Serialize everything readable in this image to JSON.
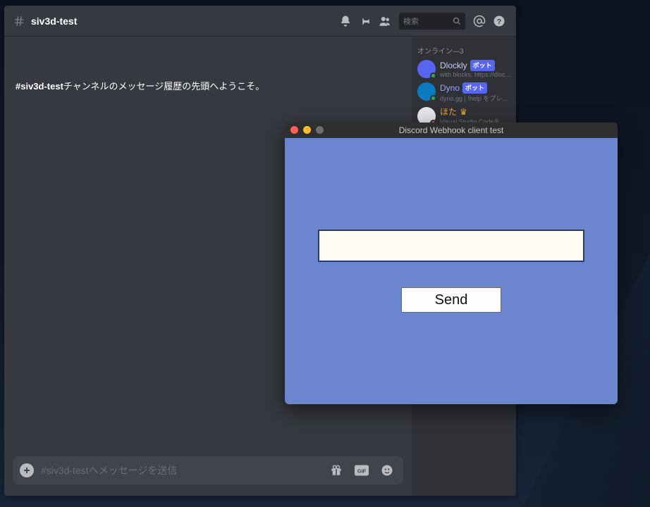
{
  "discord": {
    "channel_name": "siv3d-test",
    "welcome_prefix": "#siv3d-test",
    "welcome_suffix": "チャンネルのメッセージ履歴の先頭へようこそ。",
    "search_placeholder": "検索",
    "message_placeholder": "#siv3d-testへメッセージを送信",
    "members_heading": "オンライン―3",
    "members": [
      {
        "name": "Dlockly",
        "name_color": "#c9cdfb",
        "bot": true,
        "bot_label": "ボット",
        "sub": "with blocks. https://dlockly.gl...",
        "avatar_bg": "#5865f2",
        "status": "#3ba55d"
      },
      {
        "name": "Dyno",
        "name_color": "#9aa0ff",
        "bot": true,
        "bot_label": "ボット",
        "sub": "dyno.gg | !help をプレイ中",
        "avatar_bg": "#0b7bc1",
        "status": "#3ba55d"
      },
      {
        "name": "ほた",
        "name_color": "#e9a23b",
        "crown": "♛",
        "bot": false,
        "sub": "Visual Studio Codeをプレ...",
        "avatar_bg": "#e4e6ea",
        "status": "#ed4245"
      }
    ]
  },
  "app": {
    "window_title": "Discord Webhook client test",
    "send_label": "Send",
    "input_value": ""
  }
}
